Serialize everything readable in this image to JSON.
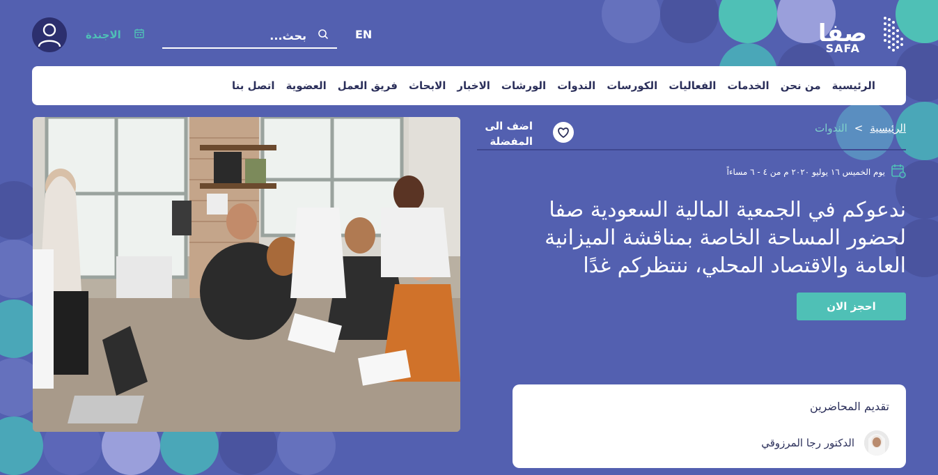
{
  "header": {
    "logo_ar": "صفا",
    "logo_en": "SAFA",
    "lang_label": "EN",
    "search_placeholder": "بحث...",
    "agenda_label": "الاجندة"
  },
  "nav": {
    "items": [
      "الرئيسية",
      "من نحن",
      "الخدمات",
      "الفعاليات",
      "الكورسات",
      "الندوات",
      "الورشات",
      "الاخبار",
      "الابحاث",
      "فريق العمل",
      "العضوية",
      "اتصل بنا"
    ]
  },
  "breadcrumb": {
    "home": "الرئيسية",
    "separator": ">",
    "current": "الندوات"
  },
  "favorite": {
    "label": "اضف الى المفضلة"
  },
  "event": {
    "date": "يوم الخميس ١٦ يوليو ٢٠٢٠ م من ٤ - ٦ مساءاً",
    "title": "ندعوكم في الجمعية المالية السعودية صفا لحضور المساحة الخاصة بمناقشة الميزانية العامة والاقتصاد المحلي، ننتظركم غدًا",
    "book_label": "احجز الان"
  },
  "speakers": {
    "title": "تقديم المحاضرين",
    "items": [
      {
        "name": "الدكتور رجا المرزوقي"
      }
    ]
  },
  "colors": {
    "background": "#5360b0",
    "accent": "#4fc0b6",
    "nav_text": "#2b2f5a"
  }
}
